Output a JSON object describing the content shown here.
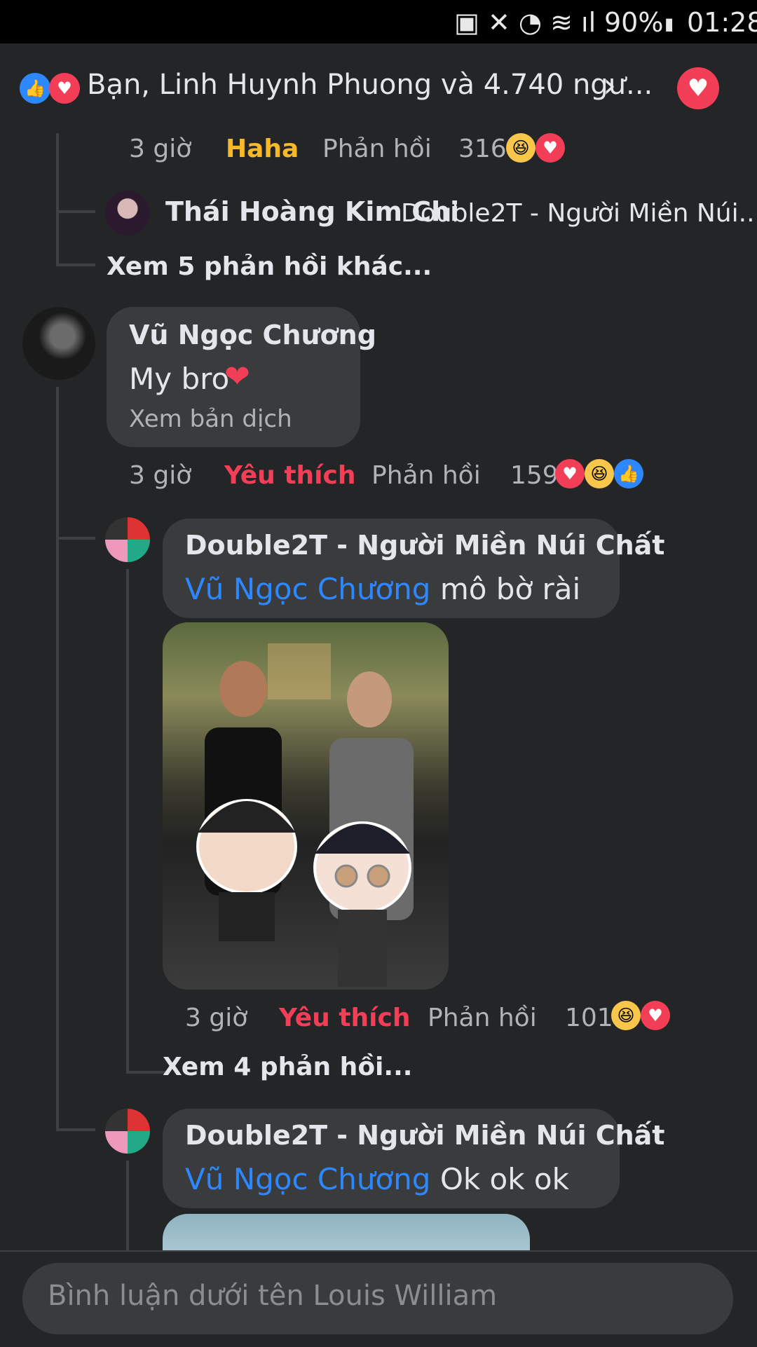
{
  "status_bar": {
    "battery": "90%",
    "time": "01:28"
  },
  "summary": {
    "text": "Bạn, Linh Huynh Phuong và 4.740 ngư...",
    "heart_button_icon": "heart-icon"
  },
  "comments": [
    {
      "meta": {
        "time": "3 giờ",
        "reaction": "Haha",
        "reply": "Phản hồi",
        "count": "316"
      }
    },
    {
      "author": "Thái Hoàng Kim Chi",
      "preview": "Double2T - Người Miền Núi..."
    },
    {
      "more": "Xem 5 phản hồi khác..."
    },
    {
      "author": "Vũ Ngọc Chương",
      "text": "My bro",
      "translate": "Xem bản dịch",
      "meta": {
        "time": "3 giờ",
        "reaction": "Yêu thích",
        "reply": "Phản hồi",
        "count": "159"
      }
    },
    {
      "author": "Double2T - Người Miền Núi Chất",
      "mention": "Vũ Ngọc Chương",
      "text": "mô bờ rài",
      "meta": {
        "time": "3 giờ",
        "reaction": "Yêu thích",
        "reply": "Phản hồi",
        "count": "101"
      },
      "more": "Xem 4 phản hồi..."
    },
    {
      "author": "Double2T - Người Miền Núi Chất",
      "mention": "Vũ Ngọc Chương",
      "text": "Ok ok ok"
    }
  ],
  "composer": {
    "placeholder": "Bình luận dưới tên Louis William"
  },
  "colors": {
    "background": "#242526",
    "love": "#f33e58",
    "haha": "#f7b928",
    "link": "#2d88ff"
  }
}
